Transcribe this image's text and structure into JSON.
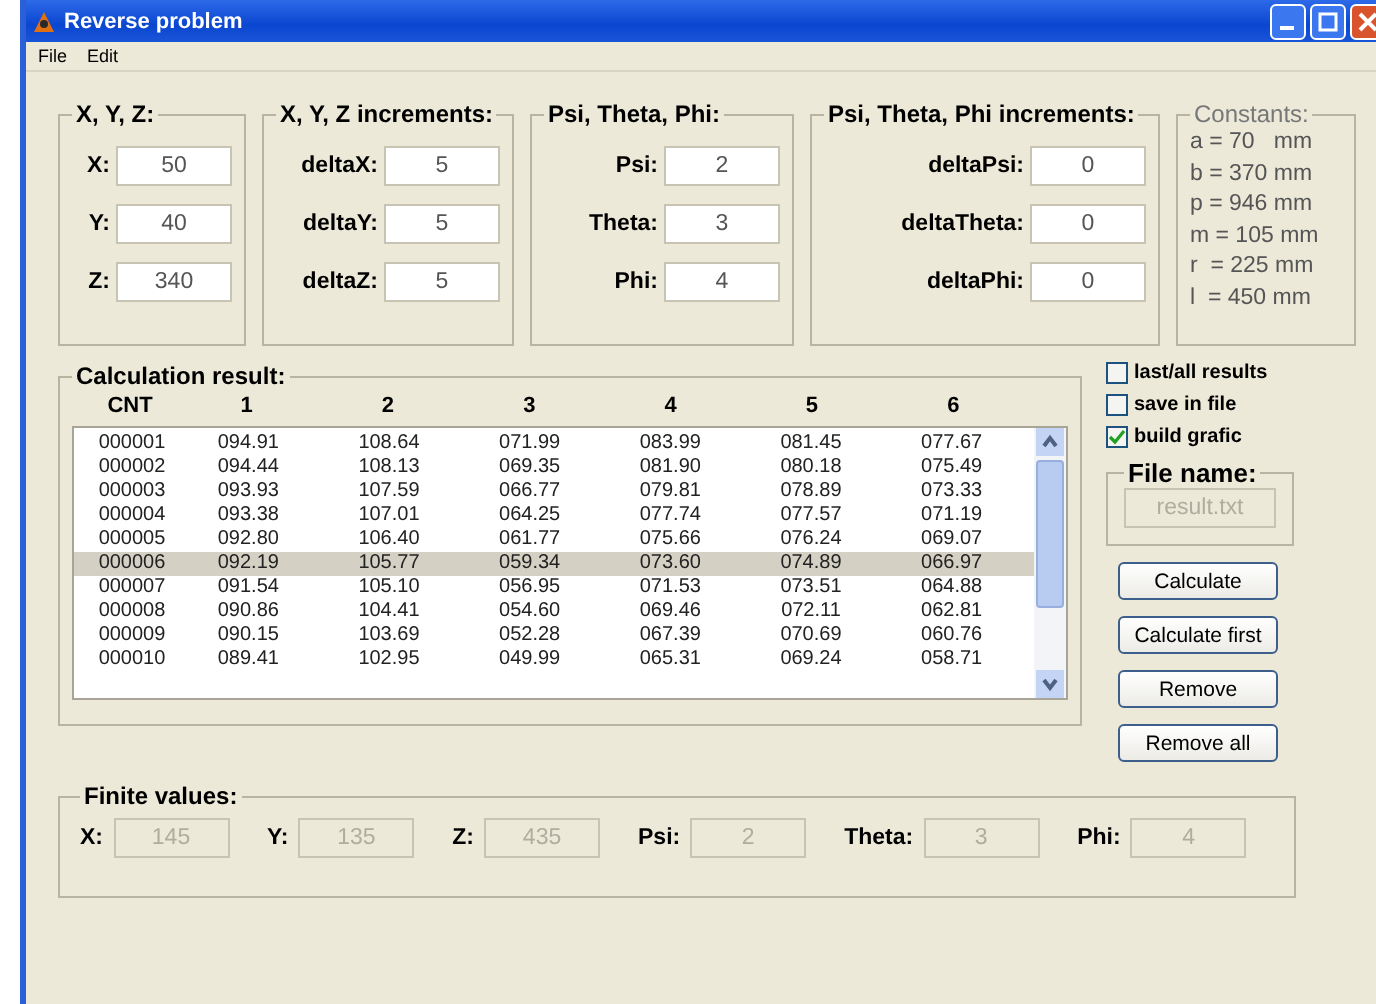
{
  "window": {
    "title": "Reverse problem"
  },
  "menu": [
    "File",
    "Edit"
  ],
  "groups": [
    {
      "title": "X, Y, Z:",
      "fields": [
        {
          "label": "X:",
          "value": "50"
        },
        {
          "label": "Y:",
          "value": "40"
        },
        {
          "label": "Z:",
          "value": "340"
        }
      ]
    },
    {
      "title": "X, Y, Z increments:",
      "fields": [
        {
          "label": "deltaX:",
          "value": "5"
        },
        {
          "label": "deltaY:",
          "value": "5"
        },
        {
          "label": "deltaZ:",
          "value": "5"
        }
      ]
    },
    {
      "title": "Psi, Theta, Phi:",
      "fields": [
        {
          "label": "Psi:",
          "value": "2"
        },
        {
          "label": "Theta:",
          "value": "3"
        },
        {
          "label": "Phi:",
          "value": "4"
        }
      ]
    },
    {
      "title": "Psi, Theta, Phi increments:",
      "fields": [
        {
          "label": "deltaPsi:",
          "value": "0"
        },
        {
          "label": "deltaTheta:",
          "value": "0"
        },
        {
          "label": "deltaPhi:",
          "value": "0"
        }
      ]
    }
  ],
  "constants": {
    "title": "Constants:",
    "lines": [
      "a = 70   mm",
      "b = 370 mm",
      "p = 946 mm",
      "m = 105 mm",
      "r  = 225 mm",
      "l  = 450 mm"
    ]
  },
  "results": {
    "title": "Calculation result:",
    "columns": [
      "CNT",
      "1",
      "2",
      "3",
      "4",
      "5",
      "6"
    ],
    "rows": [
      {
        "cells": [
          "000001",
          "094.91",
          "108.64",
          "071.99",
          "083.99",
          "081.45",
          "077.67"
        ],
        "selected": false
      },
      {
        "cells": [
          "000002",
          "094.44",
          "108.13",
          "069.35",
          "081.90",
          "080.18",
          "075.49"
        ],
        "selected": false
      },
      {
        "cells": [
          "000003",
          "093.93",
          "107.59",
          "066.77",
          "079.81",
          "078.89",
          "073.33"
        ],
        "selected": false
      },
      {
        "cells": [
          "000004",
          "093.38",
          "107.01",
          "064.25",
          "077.74",
          "077.57",
          "071.19"
        ],
        "selected": false
      },
      {
        "cells": [
          "000005",
          "092.80",
          "106.40",
          "061.77",
          "075.66",
          "076.24",
          "069.07"
        ],
        "selected": false
      },
      {
        "cells": [
          "000006",
          "092.19",
          "105.77",
          "059.34",
          "073.60",
          "074.89",
          "066.97"
        ],
        "selected": true
      },
      {
        "cells": [
          "000007",
          "091.54",
          "105.10",
          "056.95",
          "071.53",
          "073.51",
          "064.88"
        ],
        "selected": false
      },
      {
        "cells": [
          "000008",
          "090.86",
          "104.41",
          "054.60",
          "069.46",
          "072.11",
          "062.81"
        ],
        "selected": false
      },
      {
        "cells": [
          "000009",
          "090.15",
          "103.69",
          "052.28",
          "067.39",
          "070.69",
          "060.76"
        ],
        "selected": false
      },
      {
        "cells": [
          "000010",
          "089.41",
          "102.95",
          "049.99",
          "065.31",
          "069.24",
          "058.71"
        ],
        "selected": false
      }
    ]
  },
  "options": [
    {
      "label": "last/all results",
      "checked": false
    },
    {
      "label": "save in file",
      "checked": false
    },
    {
      "label": "build grafic",
      "checked": true
    }
  ],
  "file_name": {
    "title": "File name:",
    "value": "result.txt",
    "disabled": true
  },
  "buttons": [
    "Calculate",
    "Calculate first",
    "Remove",
    "Remove all"
  ],
  "finite": {
    "title": "Finite values:",
    "fields": [
      {
        "label": "X:",
        "value": "145",
        "disabled": true
      },
      {
        "label": "Y:",
        "value": "135",
        "disabled": true
      },
      {
        "label": "Z:",
        "value": "435",
        "disabled": true
      },
      {
        "label": "Psi:",
        "value": "2",
        "disabled": true
      },
      {
        "label": "Theta:",
        "value": "3",
        "disabled": true
      },
      {
        "label": "Phi:",
        "value": "4",
        "disabled": true
      }
    ]
  }
}
